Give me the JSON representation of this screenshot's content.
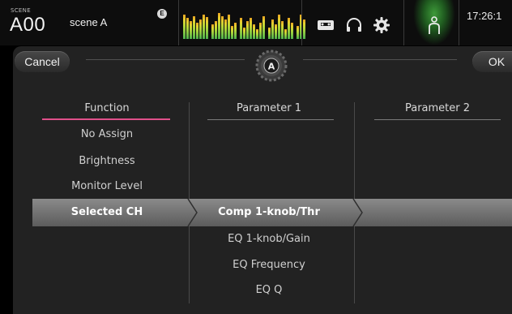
{
  "topbar": {
    "scene_label": "SCENE",
    "scene_number": "A00",
    "scene_name": "scene A",
    "edit_badge": "E",
    "clock": "17:26:1",
    "icons": [
      "recorder-icon",
      "headphones-icon",
      "settings-gear-icon",
      "user-icon"
    ]
  },
  "dialog": {
    "cancel_label": "Cancel",
    "ok_label": "OK",
    "header_icon": "assign-knob-A-gear-icon",
    "header_icon_letter": "A"
  },
  "columns": {
    "function": {
      "title": "Function",
      "items": [
        "No Assign",
        "Brightness",
        "Monitor Level",
        "Selected CH"
      ],
      "selected": "Selected CH"
    },
    "parameter1": {
      "title": "Parameter 1",
      "items": [
        "Comp 1-knob/Thr",
        "EQ 1-knob/Gain",
        "EQ Frequency",
        "EQ Q"
      ],
      "selected": "Comp 1-knob/Thr"
    },
    "parameter2": {
      "title": "Parameter 2",
      "items": []
    }
  },
  "colors": {
    "function_underline": "#e0508a",
    "selected_row": "#7a7a7a",
    "panel": "#222222",
    "active_user": "#3e9a3a"
  }
}
